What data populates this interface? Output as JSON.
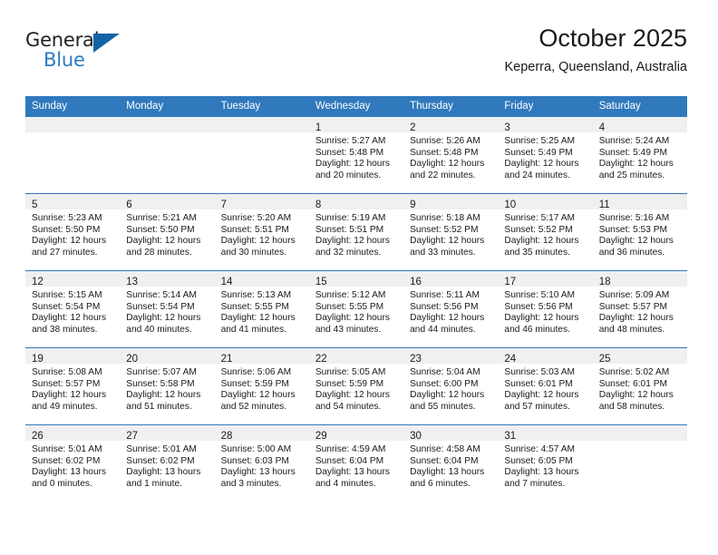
{
  "brand": {
    "word_general": "General",
    "word_blue": "Blue",
    "triangle_color": "#1464a5",
    "blue_color": "#2b7cc3"
  },
  "header": {
    "title": "October 2025",
    "location": "Keperra, Queensland, Australia"
  },
  "calendar": {
    "header_bg": "#3079bd",
    "daynum_bg": "#f0f0f0",
    "weekday_headers": [
      "Sunday",
      "Monday",
      "Tuesday",
      "Wednesday",
      "Thursday",
      "Friday",
      "Saturday"
    ],
    "weeks": [
      [
        {
          "day": "",
          "empty": true,
          "lines": []
        },
        {
          "day": "",
          "empty": true,
          "lines": []
        },
        {
          "day": "",
          "empty": true,
          "lines": []
        },
        {
          "day": "1",
          "empty": false,
          "lines": [
            "Sunrise: 5:27 AM",
            "Sunset: 5:48 PM",
            "Daylight: 12 hours",
            "and 20 minutes."
          ]
        },
        {
          "day": "2",
          "empty": false,
          "lines": [
            "Sunrise: 5:26 AM",
            "Sunset: 5:48 PM",
            "Daylight: 12 hours",
            "and 22 minutes."
          ]
        },
        {
          "day": "3",
          "empty": false,
          "lines": [
            "Sunrise: 5:25 AM",
            "Sunset: 5:49 PM",
            "Daylight: 12 hours",
            "and 24 minutes."
          ]
        },
        {
          "day": "4",
          "empty": false,
          "lines": [
            "Sunrise: 5:24 AM",
            "Sunset: 5:49 PM",
            "Daylight: 12 hours",
            "and 25 minutes."
          ]
        }
      ],
      [
        {
          "day": "5",
          "empty": false,
          "lines": [
            "Sunrise: 5:23 AM",
            "Sunset: 5:50 PM",
            "Daylight: 12 hours",
            "and 27 minutes."
          ]
        },
        {
          "day": "6",
          "empty": false,
          "lines": [
            "Sunrise: 5:21 AM",
            "Sunset: 5:50 PM",
            "Daylight: 12 hours",
            "and 28 minutes."
          ]
        },
        {
          "day": "7",
          "empty": false,
          "lines": [
            "Sunrise: 5:20 AM",
            "Sunset: 5:51 PM",
            "Daylight: 12 hours",
            "and 30 minutes."
          ]
        },
        {
          "day": "8",
          "empty": false,
          "lines": [
            "Sunrise: 5:19 AM",
            "Sunset: 5:51 PM",
            "Daylight: 12 hours",
            "and 32 minutes."
          ]
        },
        {
          "day": "9",
          "empty": false,
          "lines": [
            "Sunrise: 5:18 AM",
            "Sunset: 5:52 PM",
            "Daylight: 12 hours",
            "and 33 minutes."
          ]
        },
        {
          "day": "10",
          "empty": false,
          "lines": [
            "Sunrise: 5:17 AM",
            "Sunset: 5:52 PM",
            "Daylight: 12 hours",
            "and 35 minutes."
          ]
        },
        {
          "day": "11",
          "empty": false,
          "lines": [
            "Sunrise: 5:16 AM",
            "Sunset: 5:53 PM",
            "Daylight: 12 hours",
            "and 36 minutes."
          ]
        }
      ],
      [
        {
          "day": "12",
          "empty": false,
          "lines": [
            "Sunrise: 5:15 AM",
            "Sunset: 5:54 PM",
            "Daylight: 12 hours",
            "and 38 minutes."
          ]
        },
        {
          "day": "13",
          "empty": false,
          "lines": [
            "Sunrise: 5:14 AM",
            "Sunset: 5:54 PM",
            "Daylight: 12 hours",
            "and 40 minutes."
          ]
        },
        {
          "day": "14",
          "empty": false,
          "lines": [
            "Sunrise: 5:13 AM",
            "Sunset: 5:55 PM",
            "Daylight: 12 hours",
            "and 41 minutes."
          ]
        },
        {
          "day": "15",
          "empty": false,
          "lines": [
            "Sunrise: 5:12 AM",
            "Sunset: 5:55 PM",
            "Daylight: 12 hours",
            "and 43 minutes."
          ]
        },
        {
          "day": "16",
          "empty": false,
          "lines": [
            "Sunrise: 5:11 AM",
            "Sunset: 5:56 PM",
            "Daylight: 12 hours",
            "and 44 minutes."
          ]
        },
        {
          "day": "17",
          "empty": false,
          "lines": [
            "Sunrise: 5:10 AM",
            "Sunset: 5:56 PM",
            "Daylight: 12 hours",
            "and 46 minutes."
          ]
        },
        {
          "day": "18",
          "empty": false,
          "lines": [
            "Sunrise: 5:09 AM",
            "Sunset: 5:57 PM",
            "Daylight: 12 hours",
            "and 48 minutes."
          ]
        }
      ],
      [
        {
          "day": "19",
          "empty": false,
          "lines": [
            "Sunrise: 5:08 AM",
            "Sunset: 5:57 PM",
            "Daylight: 12 hours",
            "and 49 minutes."
          ]
        },
        {
          "day": "20",
          "empty": false,
          "lines": [
            "Sunrise: 5:07 AM",
            "Sunset: 5:58 PM",
            "Daylight: 12 hours",
            "and 51 minutes."
          ]
        },
        {
          "day": "21",
          "empty": false,
          "lines": [
            "Sunrise: 5:06 AM",
            "Sunset: 5:59 PM",
            "Daylight: 12 hours",
            "and 52 minutes."
          ]
        },
        {
          "day": "22",
          "empty": false,
          "lines": [
            "Sunrise: 5:05 AM",
            "Sunset: 5:59 PM",
            "Daylight: 12 hours",
            "and 54 minutes."
          ]
        },
        {
          "day": "23",
          "empty": false,
          "lines": [
            "Sunrise: 5:04 AM",
            "Sunset: 6:00 PM",
            "Daylight: 12 hours",
            "and 55 minutes."
          ]
        },
        {
          "day": "24",
          "empty": false,
          "lines": [
            "Sunrise: 5:03 AM",
            "Sunset: 6:01 PM",
            "Daylight: 12 hours",
            "and 57 minutes."
          ]
        },
        {
          "day": "25",
          "empty": false,
          "lines": [
            "Sunrise: 5:02 AM",
            "Sunset: 6:01 PM",
            "Daylight: 12 hours",
            "and 58 minutes."
          ]
        }
      ],
      [
        {
          "day": "26",
          "empty": false,
          "lines": [
            "Sunrise: 5:01 AM",
            "Sunset: 6:02 PM",
            "Daylight: 13 hours",
            "and 0 minutes."
          ]
        },
        {
          "day": "27",
          "empty": false,
          "lines": [
            "Sunrise: 5:01 AM",
            "Sunset: 6:02 PM",
            "Daylight: 13 hours",
            "and 1 minute."
          ]
        },
        {
          "day": "28",
          "empty": false,
          "lines": [
            "Sunrise: 5:00 AM",
            "Sunset: 6:03 PM",
            "Daylight: 13 hours",
            "and 3 minutes."
          ]
        },
        {
          "day": "29",
          "empty": false,
          "lines": [
            "Sunrise: 4:59 AM",
            "Sunset: 6:04 PM",
            "Daylight: 13 hours",
            "and 4 minutes."
          ]
        },
        {
          "day": "30",
          "empty": false,
          "lines": [
            "Sunrise: 4:58 AM",
            "Sunset: 6:04 PM",
            "Daylight: 13 hours",
            "and 6 minutes."
          ]
        },
        {
          "day": "31",
          "empty": false,
          "lines": [
            "Sunrise: 4:57 AM",
            "Sunset: 6:05 PM",
            "Daylight: 13 hours",
            "and 7 minutes."
          ]
        },
        {
          "day": "",
          "empty": true,
          "lines": []
        }
      ]
    ]
  }
}
